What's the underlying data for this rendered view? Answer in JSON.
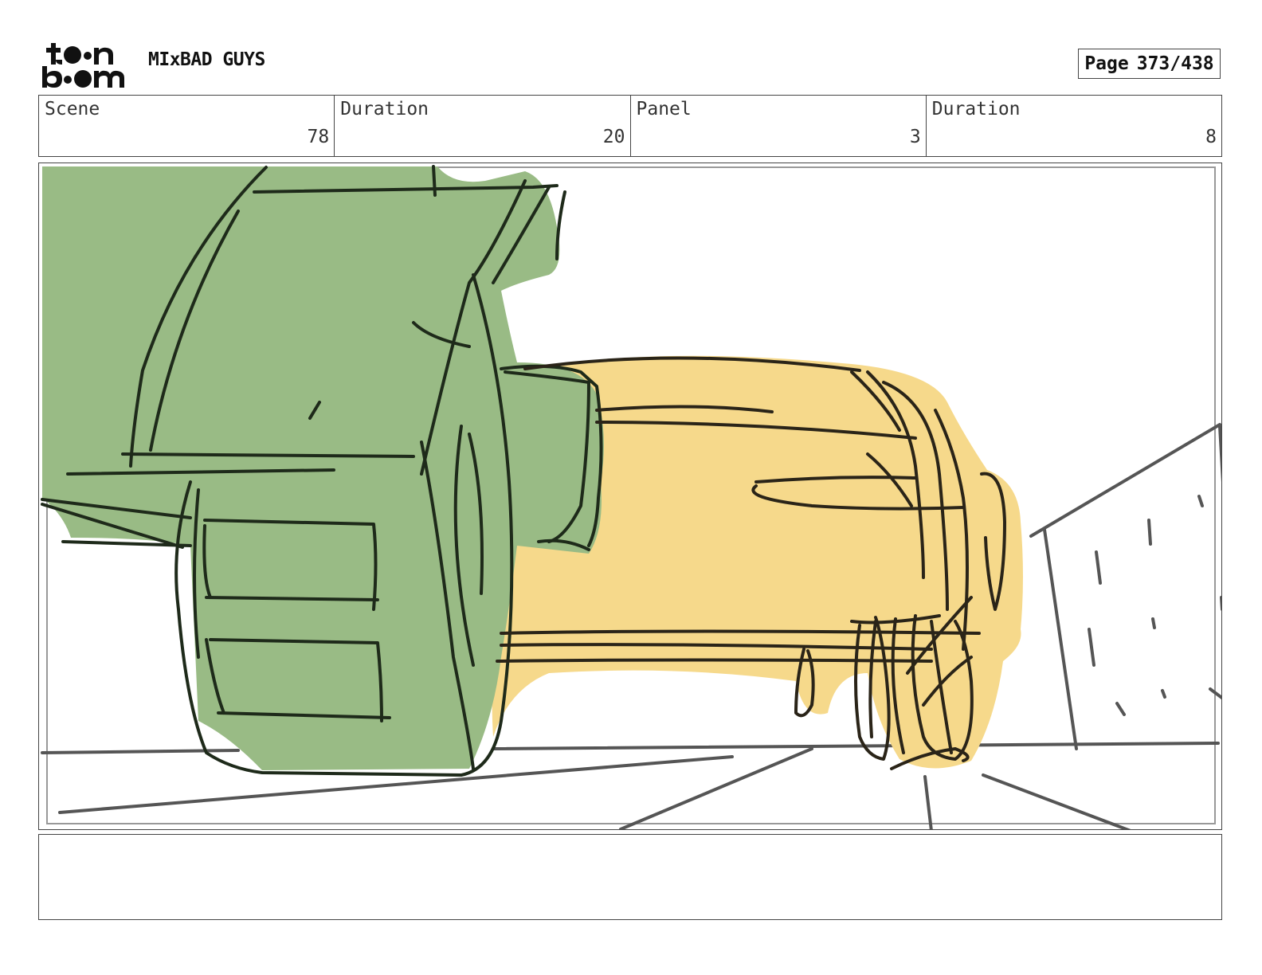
{
  "header": {
    "logo_text": "toon boom",
    "project_title": "MIxBAD GUYS",
    "page_label": "Page",
    "page_number": "373/438"
  },
  "info": {
    "scene_label": "Scene",
    "scene_value": "78",
    "scene_duration_label": "Duration",
    "scene_duration_value": "20",
    "panel_label": "Panel",
    "panel_value": "3",
    "panel_duration_label": "Duration",
    "panel_duration_value": "8"
  },
  "notes": {
    "text": ""
  }
}
